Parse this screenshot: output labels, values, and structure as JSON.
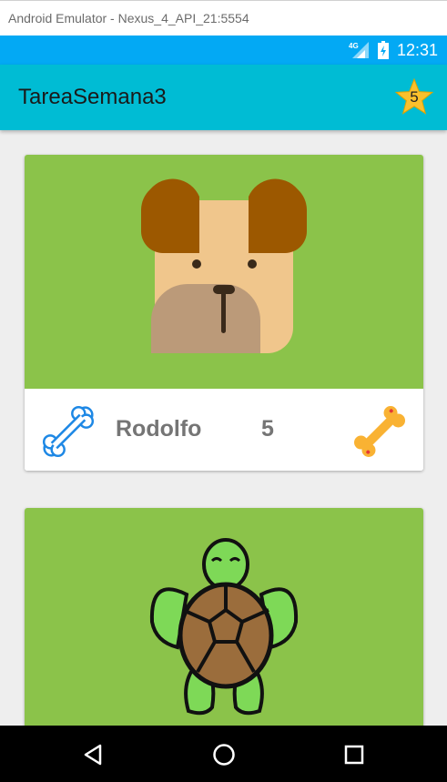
{
  "window": {
    "title": "Android Emulator - Nexus_4_API_21:5554"
  },
  "status_bar": {
    "network": "4G",
    "time": "12:31"
  },
  "app_bar": {
    "title": "TareaSemana3",
    "favorites_count": "5"
  },
  "pets": [
    {
      "name": "Rodolfo",
      "rating": "5",
      "animal": "dog"
    },
    {
      "name": "",
      "rating": "",
      "animal": "turtle"
    }
  ],
  "colors": {
    "status_bar": "#03a9f4",
    "app_bar": "#00bcd4",
    "card_image_bg": "#8bc34a",
    "star": "#fbc02d",
    "bone_outline": "#1e88e5",
    "bone_filled": "#f9b233"
  },
  "icons": {
    "favorites": "star-icon",
    "rate": "bone-outline-icon",
    "rating": "bone-filled-icon",
    "back": "back-triangle-icon",
    "home": "home-circle-icon",
    "recents": "recents-square-icon"
  }
}
